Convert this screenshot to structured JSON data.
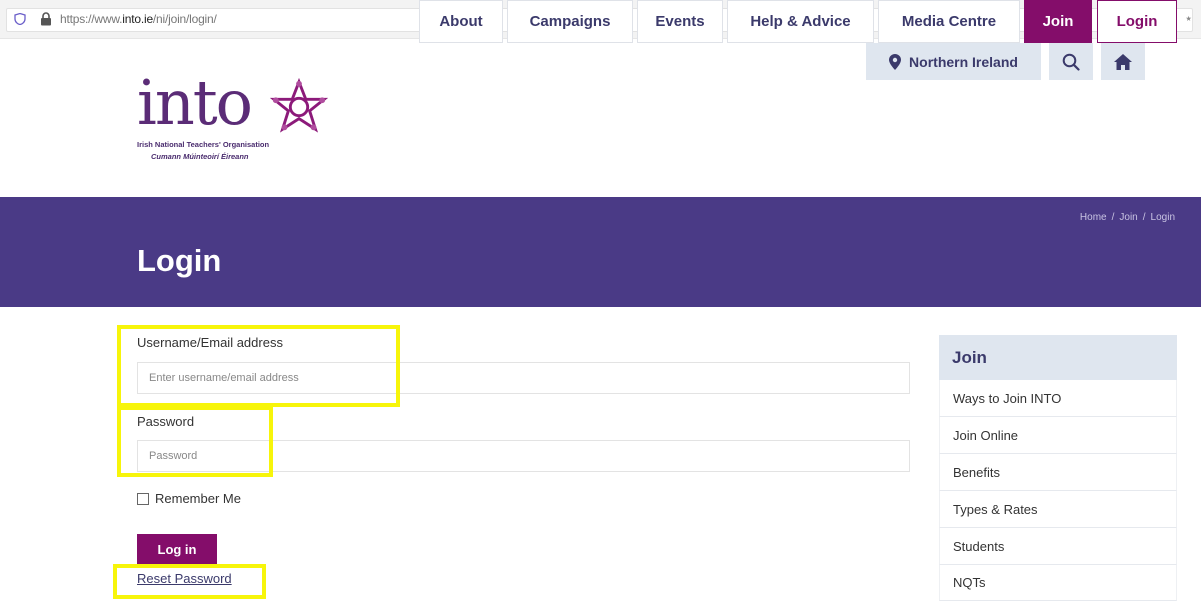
{
  "browser": {
    "url_prefix": "https://www.",
    "url_domain": "into.ie",
    "url_path": "/ni/join/login/"
  },
  "logo": {
    "wordmark": "into",
    "subtitle_line1": "Irish National Teachers' Organisation",
    "subtitle_line2": "Cumann Múinteoirí Éireann"
  },
  "utility": {
    "region_label": "Northern Ireland",
    "search_icon": "search-icon",
    "home_icon": "home-icon"
  },
  "nav": {
    "items": [
      "About",
      "Campaigns",
      "Events",
      "Help & Advice",
      "Media Centre",
      "Join",
      "Login"
    ]
  },
  "breadcrumb": {
    "items": [
      "Home",
      "Join",
      "Login"
    ],
    "separator": "/"
  },
  "page": {
    "title": "Login"
  },
  "form": {
    "username_label": "Username/Email address",
    "username_placeholder": "Enter username/email address",
    "password_label": "Password",
    "password_placeholder": "Password",
    "remember_label": "Remember Me",
    "login_button": "Log in",
    "reset_link": "Reset Password"
  },
  "sidebar": {
    "heading": "Join",
    "items": [
      "Ways to Join INTO",
      "Join Online",
      "Benefits",
      "Types & Rates",
      "Students",
      "NQTs"
    ]
  },
  "colors": {
    "brand_purple": "#4a3a86",
    "join_magenta": "#840d6a",
    "highlight_yellow": "#f7f50a",
    "nav_text": "#3b3a6b"
  }
}
